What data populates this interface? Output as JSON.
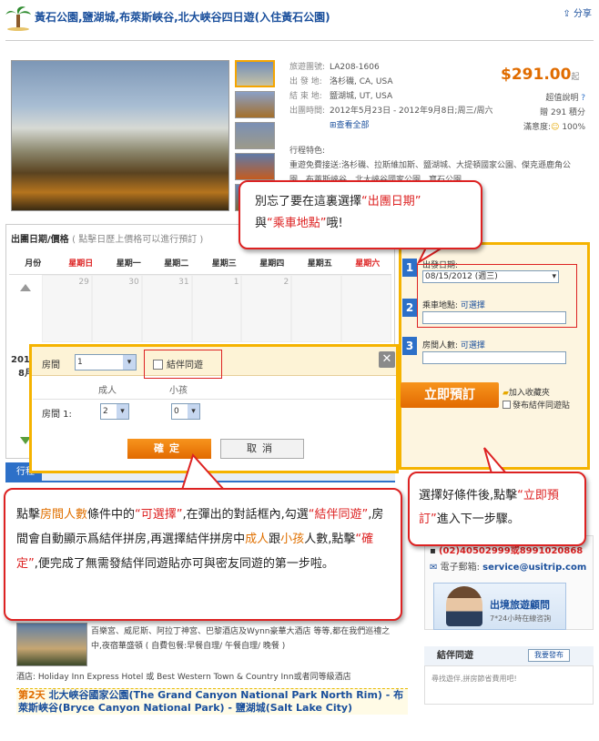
{
  "header": {
    "title": "黃石公園,鹽湖城,布萊斯峽谷,北大峽谷四日遊(入住黃石公園)",
    "share": "分享"
  },
  "info": {
    "code_label": "旅遊團號:",
    "code": "LA208-1606",
    "from_label": "出 發 地:",
    "from": "洛杉磯, CA, USA",
    "to_label": "結 束 地:",
    "to": "鹽湖城, UT, USA",
    "time_label": "出團時間:",
    "time": "2012年5月23日 - 2012年9月8日;周三/周六",
    "view_all": "查看全部",
    "feature_label": "行程特色:",
    "feature_text": "重遊免費接送:洛杉磯、拉斯維加斯、鹽湖城、大提頓國家公園、傑克遜鹿角公園、布萊斯峽谷、北大峽谷國家公園、寶石公園"
  },
  "price": {
    "value": "$291.00",
    "unit": "起",
    "note": "超值說明",
    "points_label": "贈",
    "points": "291 積分",
    "satisfaction_label": "滿意度:",
    "satisfaction": "100%"
  },
  "calendar": {
    "title": "出團日期/價格",
    "hint": "( 點擊日歷上價格可以進行預訂 )",
    "month_header": "月份",
    "days": [
      "星期日",
      "星期一",
      "星期二",
      "星期三",
      "星期四",
      "星期五",
      "星期六"
    ],
    "cells": [
      "29",
      "30",
      "31",
      "1",
      "2",
      "",
      ""
    ],
    "year_label": "2012",
    "month_label": "8月"
  },
  "booking": {
    "step1": "1",
    "step1_label": "出發日期:",
    "date_value": "08/15/2012  (週三)",
    "step2": "2",
    "step2_label": "乘車地點:",
    "step2_link": "可選擇",
    "step3": "3",
    "step3_label": "房間人數:",
    "step3_link": "可選擇",
    "book_button": "立即預訂",
    "fav": "加入收藏夾",
    "post": "發布結伴同遊貼"
  },
  "dialog": {
    "room_label": "房間",
    "room_value": "1",
    "companion": "結伴同遊",
    "adult_header": "成人",
    "child_header": "小孩",
    "room1_label": "房間 1:",
    "adult_value": "2",
    "child_value": "0",
    "confirm": "確定",
    "cancel": "取消",
    "close": "✕"
  },
  "callout1": {
    "a": "別忘了要在這裏選擇",
    "b": "“出團日期”",
    "c": "與",
    "d": "“乘車地點”",
    "e": "哦!"
  },
  "callout2": {
    "a": "選擇好條件後,點擊",
    "b": "“立即預訂”",
    "c": "進入下一步驟。"
  },
  "callout3": {
    "a": "點擊",
    "b": "房間人數",
    "c": "條件中的",
    "d": "“可選擇”",
    "e": ",在彈出的對話框內,勾選",
    "f": "“結伴同遊”",
    "g": ",房間會自動顯示爲結伴拼房,再選擇結伴拼房中",
    "h": "成人",
    "i": "跟",
    "j": "小孩",
    "k": "人數,點擊",
    "l": "“確定”",
    "m": ",便完成了無需發結伴同遊貼亦可與密友同遊的第一步啦。"
  },
  "tabs": {
    "active": "行程"
  },
  "contact": {
    "phone": "(02)40502999或8991020868",
    "email_label": "電子郵箱:",
    "email": "service@usitrip.com",
    "advisor": "出境旅遊顧問",
    "advisor_sub": "7*24小時在線咨詢"
  },
  "companion_box": {
    "title": "結伴同遊",
    "post_btn": "我要發布",
    "text": "尋找遊伴,拼房節省費用吧!"
  },
  "itinerary": {
    "text": "百樂宮、威尼斯、阿拉丁神宮、巴黎酒店及Wynn豪華大酒店 等等,都在我們巡禮之中,夜宿華盛頓 ( 自費包餐:早餐自理/ 午餐自理/ 晚餐 )",
    "hotel": "酒店: Holiday Inn Express Hotel 或 Best Western Town & Country Inn或者同等級酒店",
    "day2_num": "第2天",
    "day2": "北大峽谷國家公園(The Grand Canyon National Park North Rim) - 布萊斯峽谷(Bryce Canyon National Park) - 鹽湖城(Salt Lake City)"
  }
}
